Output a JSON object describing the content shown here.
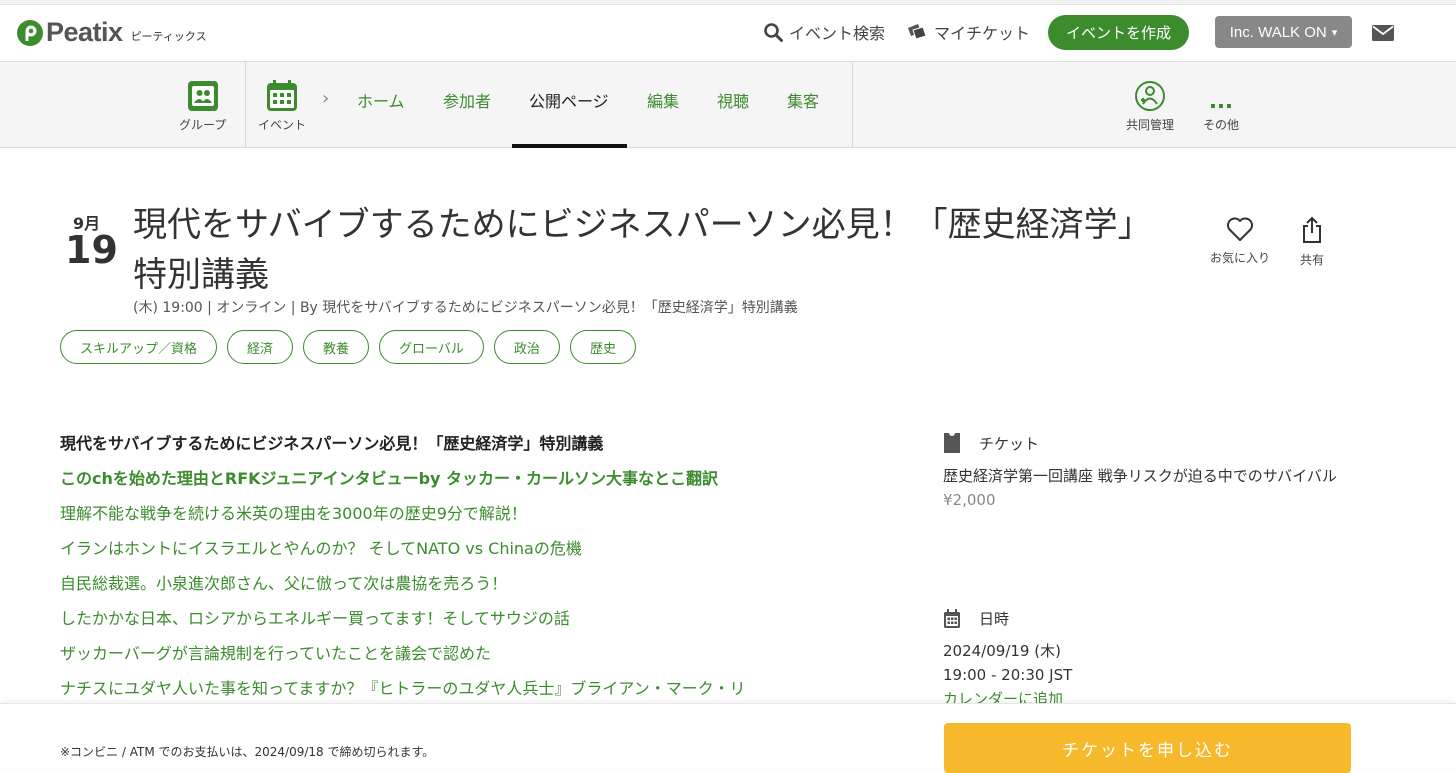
{
  "brand": {
    "name": "Peatix",
    "kana": "ピーティックス",
    "color": "#3c8c2e"
  },
  "header": {
    "search_label": "イベント検索",
    "my_tickets_label": "マイチケット",
    "create_button": "イベントを作成",
    "org_button": "Inc. WALK ON",
    "icons": [
      "search-icon",
      "ticket-icon",
      "mail-icon"
    ]
  },
  "nav": {
    "group_label": "グループ",
    "event_label": "イベント",
    "tabs": [
      {
        "label": "ホーム"
      },
      {
        "label": "参加者"
      },
      {
        "label": "公開ページ",
        "active": true
      },
      {
        "label": "編集"
      },
      {
        "label": "視聴"
      },
      {
        "label": "集客"
      }
    ],
    "co_manage_label": "共同管理",
    "more_label": "その他"
  },
  "event": {
    "month": "9月",
    "day": "19",
    "title": "現代をサバイブするためにビジネスパーソン必見！「歴史経済学」特別講義",
    "meta": "(木) 19:00 | オンライン | By 現代をサバイブするためにビジネスパーソン必見！「歴史経済学」特別講義",
    "favorite_label": "お気に入り",
    "share_label": "共有",
    "tags": [
      "スキルアップ／資格",
      "経済",
      "教養",
      "グローバル",
      "政治",
      "歴史"
    ]
  },
  "description": {
    "heading": "現代をサバイブするためにビジネスパーソン必見！「歴史経済学」特別講義",
    "links": [
      {
        "text": "このchを始めた理由とRFKジュニアインタビューby タッカー・カールソン大事なとこ翻訳",
        "bold": true
      },
      {
        "text": "理解不能な戦争を続ける米英の理由を3000年の歴史9分で解説！"
      },
      {
        "text": "イランはホントにイスラエルとやんのか？ そしてNATO vs Chinaの危機"
      },
      {
        "text": "自民総裁選。小泉進次郎さん、父に倣って次は農協を売ろう！"
      },
      {
        "text": "したかかな日本、ロシアからエネルギー買ってます！そしてサウジの話"
      },
      {
        "text": "ザッカーバーグが言論規制を行っていたことを議会で認めた"
      },
      {
        "text": "ナチスにユダヤ人いた事を知ってますか？『ヒトラーのユダヤ人兵士』ブライアン・マーク・リ"
      }
    ]
  },
  "sidebar": {
    "ticket_heading": "チケット",
    "ticket_name": "歴史経済学第一回講座 戦争リスクが迫る中でのサバイバル",
    "ticket_price": "¥2,000",
    "datetime_heading": "日時",
    "date": "2024/09/19 (木)",
    "time": "19:00 - 20:30 JST",
    "calendar_link": "カレンダーに追加"
  },
  "footer": {
    "note": "※コンビニ / ATM でのお支払いは、2024/09/18 で締め切られます。",
    "ticket_button": "チケットを申し込む",
    "button_color": "#f6b92b"
  }
}
